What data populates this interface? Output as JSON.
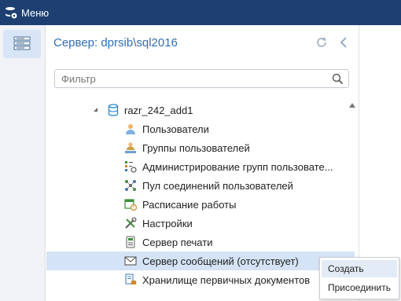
{
  "titlebar": {
    "title": "Меню",
    "icon": "database-gear-icon"
  },
  "left_rail": {
    "active_icon": "server-list-icon"
  },
  "panel": {
    "title": "Сервер: dprsib\\sql2016",
    "refresh_icon": "refresh-icon",
    "back_icon": "chevron-left-icon"
  },
  "filter": {
    "placeholder": "Фильтр",
    "value": ""
  },
  "tree": {
    "database": {
      "label": "razr_242_add1",
      "icon": "database-icon",
      "expanded": true
    },
    "items": [
      {
        "label": "Пользователи",
        "icon": "users-icon"
      },
      {
        "label": "Группы пользователей",
        "icon": "user-groups-icon"
      },
      {
        "label": "Администрирование групп пользовате...",
        "icon": "group-admin-icon"
      },
      {
        "label": "Пул соединений пользователей",
        "icon": "connection-pool-icon"
      },
      {
        "label": "Расписание работы",
        "icon": "schedule-icon"
      },
      {
        "label": "Настройки",
        "icon": "settings-tools-icon"
      },
      {
        "label": "Сервер печати",
        "icon": "print-server-icon"
      },
      {
        "label": "Сервер сообщений (отсутствует)",
        "icon": "mail-icon",
        "selected": true
      },
      {
        "label": "Хранилище первичных документов",
        "icon": "document-storage-icon"
      }
    ]
  },
  "context_menu": {
    "items": [
      {
        "label": "Создать",
        "highlighted": true
      },
      {
        "label": "Присоединить"
      }
    ]
  },
  "colors": {
    "titlebar_bg": "#1d3f72",
    "accent": "#2f6fb2",
    "selection": "#d4e3f5"
  }
}
